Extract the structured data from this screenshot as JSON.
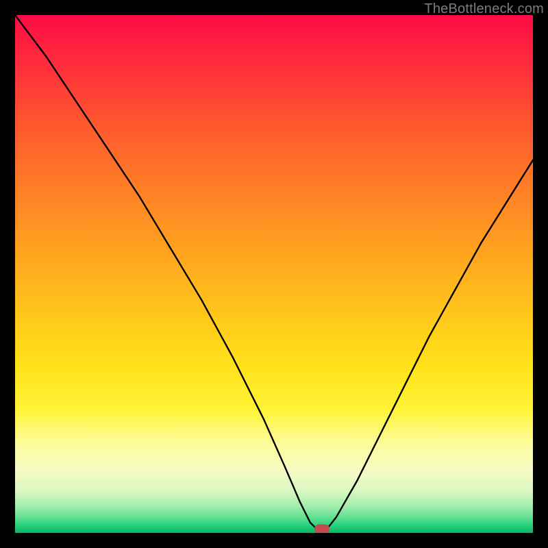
{
  "watermark": "TheBottleneck.com",
  "chart_data": {
    "type": "line",
    "title": "",
    "xlabel": "",
    "ylabel": "",
    "xlim": [
      0,
      100
    ],
    "ylim": [
      0,
      100
    ],
    "grid": false,
    "legend": false,
    "series": [
      {
        "name": "bottleneck-curve",
        "x": [
          0,
          6,
          12,
          18,
          24,
          30,
          36,
          42,
          48,
          52,
          55,
          57,
          58.5,
          60,
          62,
          66,
          72,
          80,
          90,
          100
        ],
        "y": [
          100,
          92,
          83,
          74,
          65,
          55,
          45,
          34,
          22,
          13,
          6,
          2,
          0.5,
          0.5,
          3,
          10,
          22,
          38,
          56,
          72
        ]
      }
    ],
    "marker": {
      "x": 59.2,
      "y": 0.8
    },
    "gradient_stops": [
      {
        "pos": 0,
        "color": "#ff0b45"
      },
      {
        "pos": 10,
        "color": "#ff2f3b"
      },
      {
        "pos": 22,
        "color": "#ff5a2e"
      },
      {
        "pos": 34,
        "color": "#ff8026"
      },
      {
        "pos": 46,
        "color": "#ffa41f"
      },
      {
        "pos": 58,
        "color": "#ffc71a"
      },
      {
        "pos": 68,
        "color": "#ffe21a"
      },
      {
        "pos": 76,
        "color": "#fff336"
      },
      {
        "pos": 83,
        "color": "#fdfb9e"
      },
      {
        "pos": 88,
        "color": "#f6fbc4"
      },
      {
        "pos": 92,
        "color": "#d9f7c2"
      },
      {
        "pos": 95,
        "color": "#9eedac"
      },
      {
        "pos": 97.5,
        "color": "#4fdc8c"
      },
      {
        "pos": 100,
        "color": "#00b964"
      }
    ]
  }
}
